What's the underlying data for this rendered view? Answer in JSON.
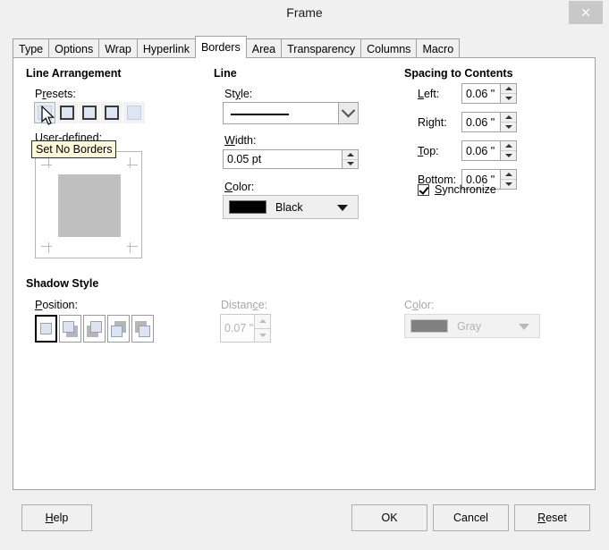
{
  "window": {
    "title": "Frame",
    "close_label": "✕"
  },
  "tabs": [
    {
      "label": "Type",
      "active": false
    },
    {
      "label": "Options",
      "active": false
    },
    {
      "label": "Wrap",
      "active": false
    },
    {
      "label": "Hyperlink",
      "active": false
    },
    {
      "label": "Borders",
      "active": true
    },
    {
      "label": "Area",
      "active": false
    },
    {
      "label": "Transparency",
      "active": false
    },
    {
      "label": "Columns",
      "active": false
    },
    {
      "label": "Macro",
      "active": false
    }
  ],
  "line_arrangement": {
    "group_title": "Line Arrangement",
    "presets_label": "Presets:",
    "presets": [
      {
        "name": "set-no-borders",
        "tooltip": "Set No Borders",
        "hovered": true
      },
      {
        "name": "box-outer-border-only",
        "hovered": false
      },
      {
        "name": "box-outer-border-horizontal-lines",
        "hovered": false
      },
      {
        "name": "box-outer-border-all-inner-lines",
        "hovered": false
      },
      {
        "name": "box-outer-border-unchanged-inner-lines",
        "hovered": false
      }
    ],
    "user_defined_label": "User-defined:",
    "tooltip_text": "Set No Borders"
  },
  "line": {
    "group_title": "Line",
    "style_label": "Style:",
    "style_value": "solid-line",
    "width_label": "Width:",
    "width_value": "0.05 pt",
    "color_label": "Color:",
    "color_value": "Black",
    "color_hex": "#000000"
  },
  "spacing": {
    "group_title": "Spacing to Contents",
    "fields": [
      {
        "label": "Left:",
        "value": "0.06 \""
      },
      {
        "label": "Right:",
        "value": "0.06 \""
      },
      {
        "label": "Top:",
        "value": "0.06 \""
      },
      {
        "label": "Bottom:",
        "value": "0.06 \""
      }
    ],
    "synchronize_label": "Synchronize",
    "synchronize_checked": true
  },
  "shadow": {
    "group_title": "Shadow Style",
    "position_label": "Position:",
    "positions": [
      {
        "name": "no-shadow",
        "selected": true
      },
      {
        "name": "shadow-bottom-right",
        "selected": false
      },
      {
        "name": "shadow-top-right",
        "selected": false
      },
      {
        "name": "shadow-bottom-left",
        "selected": false
      },
      {
        "name": "shadow-top-left",
        "selected": false
      }
    ],
    "distance_label": "Distance:",
    "distance_value": "0.07 \"",
    "distance_enabled": false,
    "color_label": "Color:",
    "color_value": "Gray",
    "color_hex": "#808080",
    "color_enabled": false
  },
  "buttons": {
    "help": "Help",
    "ok": "OK",
    "cancel": "Cancel",
    "reset": "Reset"
  }
}
